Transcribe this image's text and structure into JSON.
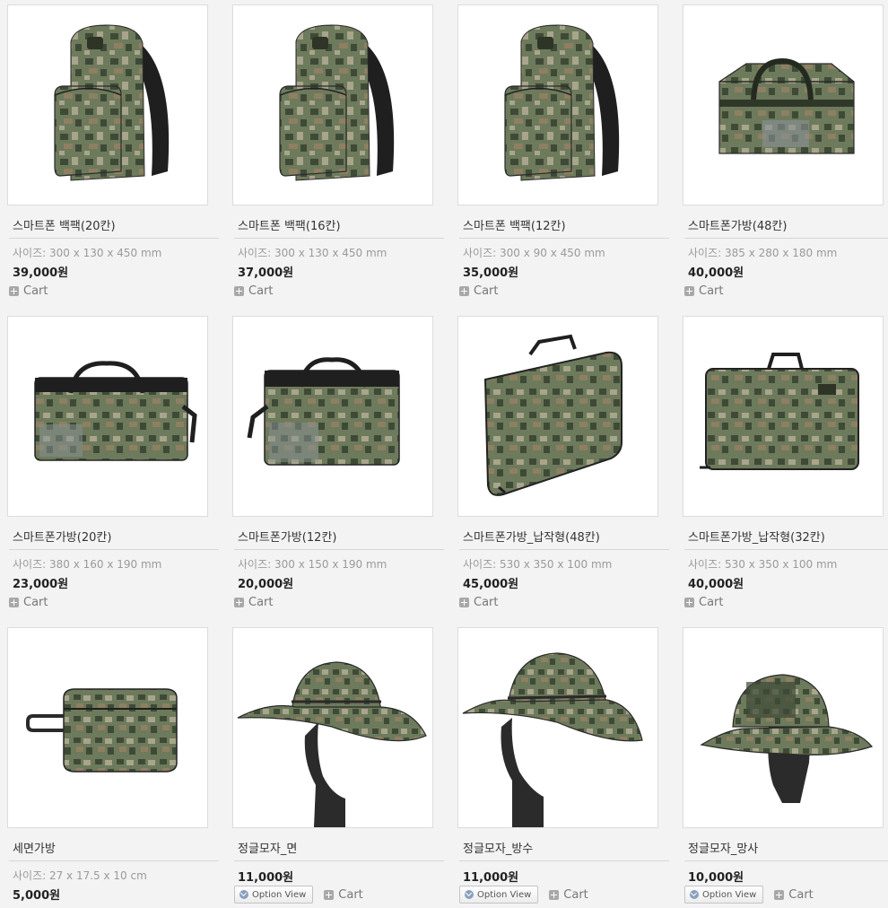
{
  "products": [
    {
      "name": "스마트폰 백팩(20칸)",
      "size": "사이즈: 300 x 130 x 450 mm",
      "price": "39,000원",
      "cart": "Cart",
      "image": "backpack-camo"
    },
    {
      "name": "스마트폰 백팩(16칸)",
      "size": "사이즈: 300 x 130 x 450 mm",
      "price": "37,000원",
      "cart": "Cart",
      "image": "backpack-camo"
    },
    {
      "name": "스마트폰 백팩(12칸)",
      "size": "사이즈: 300 x 90 x 450 mm",
      "price": "35,000원",
      "cart": "Cart",
      "image": "backpack-camo"
    },
    {
      "name": "스마트폰가방(48칸)",
      "size": "사이즈: 385 x 280 x 180 mm",
      "price": "40,000원",
      "cart": "Cart",
      "image": "box-bag-camo"
    },
    {
      "name": "스마트폰가방(20칸)",
      "size": "사이즈: 380 x 160 x 190 mm",
      "price": "23,000원",
      "cart": "Cart",
      "image": "duffel-bag-camo"
    },
    {
      "name": "스마트폰가방(12칸)",
      "size": "사이즈: 300 x 150 x 190 mm",
      "price": "20,000원",
      "cart": "Cart",
      "image": "duffel-bag-camo"
    },
    {
      "name": "스마트폰가방_납작형(48칸)",
      "size": "사이즈: 530 x 350 x 100 mm",
      "price": "45,000원",
      "cart": "Cart",
      "image": "flat-case-camo"
    },
    {
      "name": "스마트폰가방_납작형(32칸)",
      "size": "사이즈: 530 x 350 x 100 mm",
      "price": "40,000원",
      "cart": "Cart",
      "image": "flat-case-camo"
    },
    {
      "name": "세면가방",
      "size": "사이즈: 27 x 17.5 x 10 cm",
      "price": "5,000원",
      "image": "pouch-camo"
    },
    {
      "name": "정글모자_면",
      "price": "11,000원",
      "option": "Option View",
      "cart": "Cart",
      "image": "boonie-hat-camo"
    },
    {
      "name": "정글모자_방수",
      "price": "11,000원",
      "option": "Option View",
      "cart": "Cart",
      "image": "boonie-hat-camo"
    },
    {
      "name": "정글모자_망사",
      "price": "10,000원",
      "option": "Option View",
      "cart": "Cart",
      "image": "boonie-hat-camo"
    }
  ],
  "colors": {
    "camo_dark": "#3f4a36",
    "camo_mid": "#6d7a5c",
    "camo_light": "#a8a58c",
    "camo_tan": "#8f7f62",
    "strap": "#1f1f1f",
    "background": "#f3f3f3"
  }
}
